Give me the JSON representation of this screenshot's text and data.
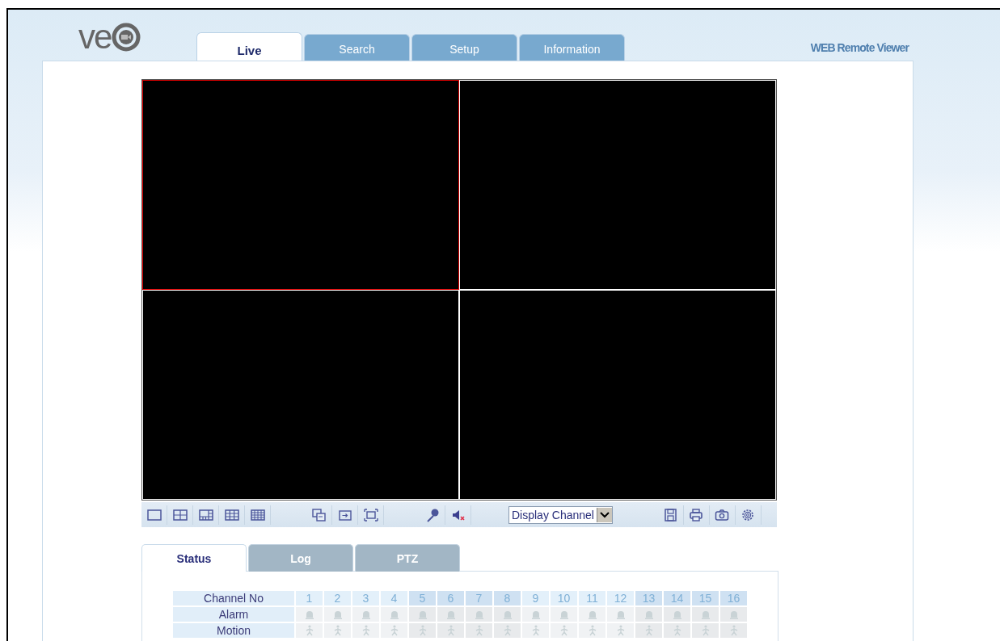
{
  "header": {
    "logo": "ve",
    "tabs": [
      {
        "label": "Live",
        "selected": true
      },
      {
        "label": "Search",
        "selected": false
      },
      {
        "label": "Setup",
        "selected": false
      },
      {
        "label": "Information",
        "selected": false
      }
    ],
    "title": "WEB Remote Viewer"
  },
  "video_grid": {
    "tiles": [
      {
        "selected": true
      },
      {
        "selected": false
      },
      {
        "selected": false
      },
      {
        "selected": false
      }
    ]
  },
  "toolbar": {
    "channel_select": {
      "value": "Display Channel"
    }
  },
  "bottom_tabs": [
    {
      "label": "Status",
      "selected": true
    },
    {
      "label": "Log",
      "selected": false
    },
    {
      "label": "PTZ",
      "selected": false
    }
  ],
  "status_table": {
    "header": "Channel No",
    "channels": [
      "1",
      "2",
      "3",
      "4",
      "5",
      "6",
      "7",
      "8",
      "9",
      "10",
      "11",
      "12",
      "13",
      "14",
      "15",
      "16"
    ],
    "rows": [
      {
        "label": "Alarm",
        "kind": "alarm"
      },
      {
        "label": "Motion",
        "kind": "motion"
      }
    ]
  }
}
